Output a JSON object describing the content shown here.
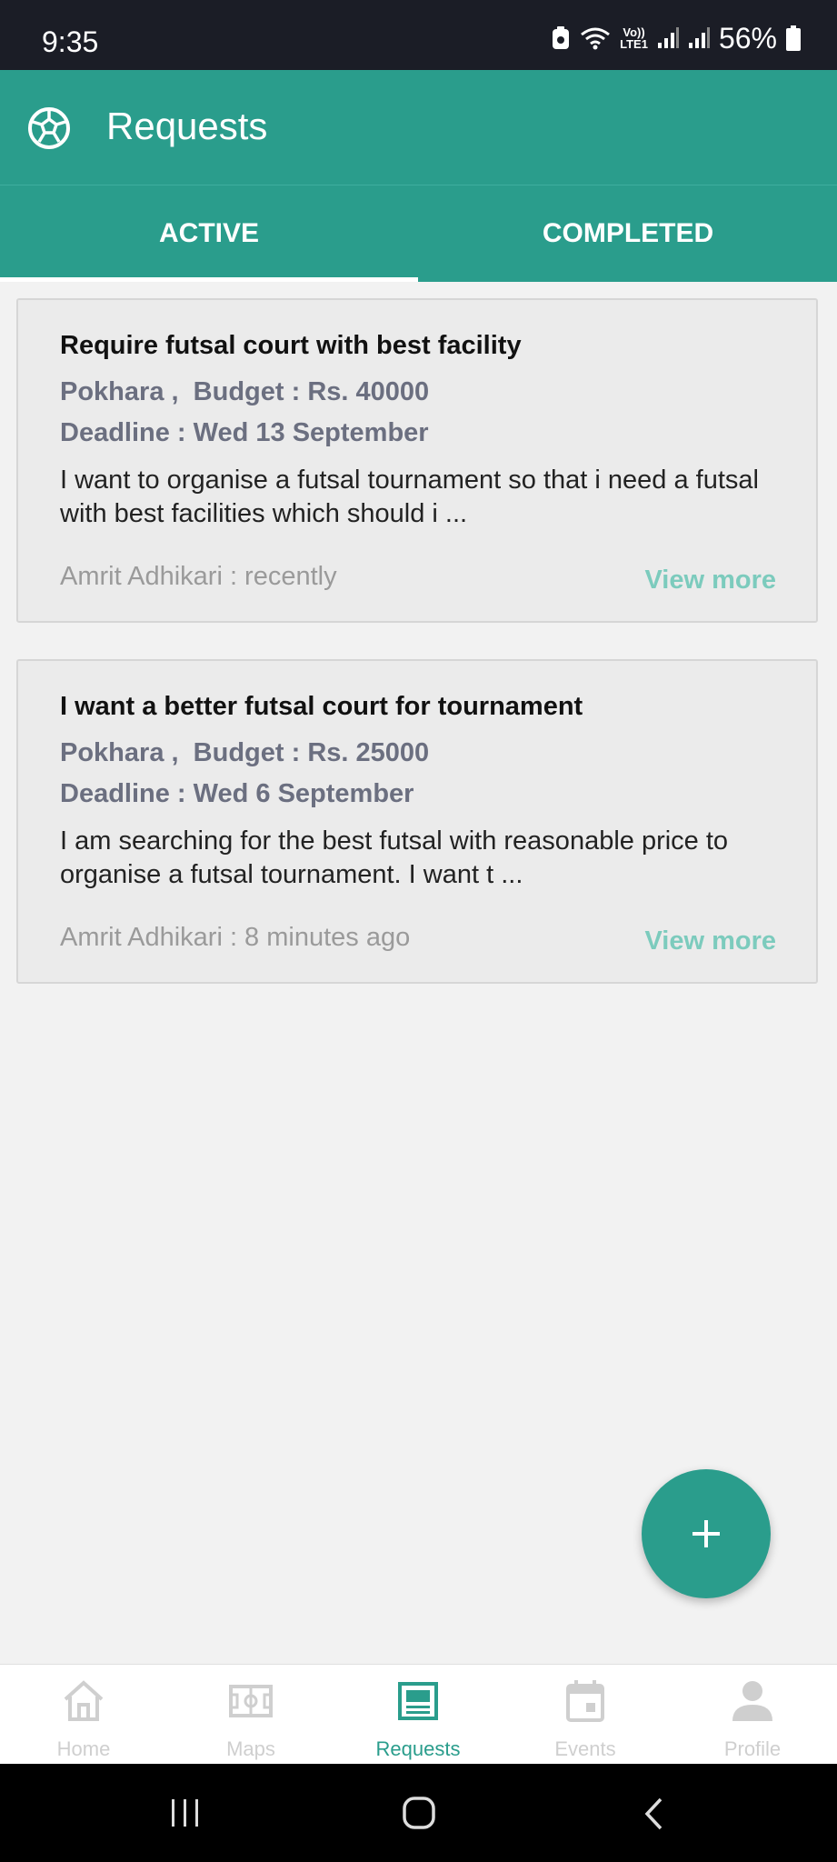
{
  "status_bar": {
    "time": "9:35",
    "network_label": "Vo))\nLTE1",
    "battery": "56%"
  },
  "app_bar": {
    "title": "Requests",
    "logo_icon": "soccer-ball-icon"
  },
  "tabs": [
    {
      "label": "ACTIVE",
      "selected": true
    },
    {
      "label": "COMPLETED",
      "selected": false
    }
  ],
  "requests": [
    {
      "title": "Require futsal court with best facility",
      "meta": "Pokhara ,  Budget : Rs. 40000",
      "deadline": "Deadline : Wed 13 September",
      "description": "I want to organise a futsal tournament so that i need a futsal with best facilities which should i ...",
      "author": "Amrit Adhikari : recently",
      "action": "View more"
    },
    {
      "title": "I want a better futsal court for tournament",
      "meta": "Pokhara ,  Budget : Rs. 25000",
      "deadline": "Deadline : Wed 6 September",
      "description": "I am searching for the best futsal with reasonable price to organise a futsal tournament. I want t ...",
      "author": "Amrit Adhikari : 8 minutes ago",
      "action": "View more"
    }
  ],
  "fab": {
    "icon": "plus-icon"
  },
  "bottom_nav": [
    {
      "label": "Home",
      "icon": "home-icon",
      "active": false
    },
    {
      "label": "Maps",
      "icon": "field-map-icon",
      "active": false
    },
    {
      "label": "Requests",
      "icon": "requests-icon",
      "active": true
    },
    {
      "label": "Events",
      "icon": "calendar-icon",
      "active": false
    },
    {
      "label": "Profile",
      "icon": "person-icon",
      "active": false
    }
  ],
  "colors": {
    "primary": "#2a9d8c",
    "accent_light": "#7ccbbd",
    "meta_text": "#6b6f80"
  }
}
